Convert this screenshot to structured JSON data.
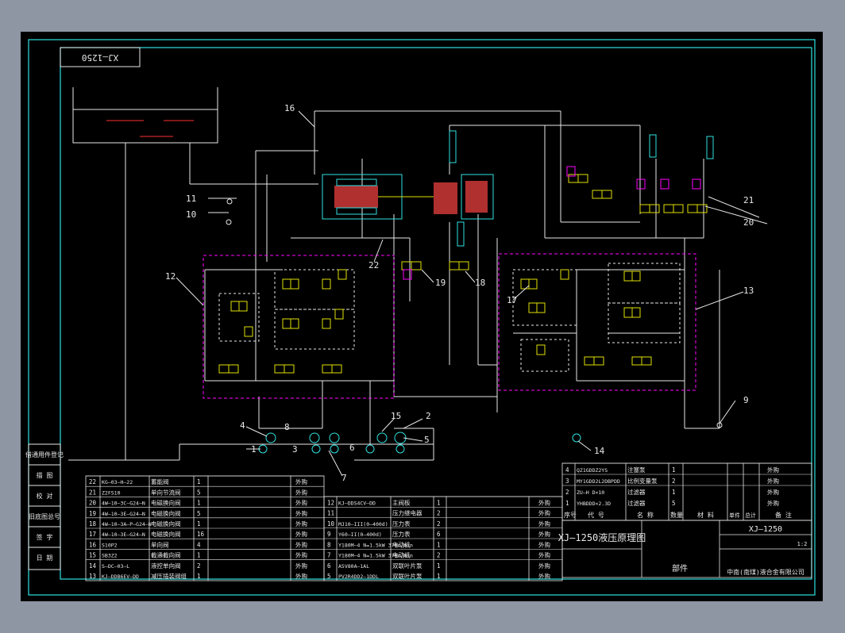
{
  "title_tag": "XJ—1250",
  "drawing": {
    "title": "XJ—1250液压原理图",
    "code": "XJ—1250",
    "part_label": "部件",
    "company": "中南(南煤)液合金有限公司",
    "scale": "1:2"
  },
  "callouts": [
    "1",
    "2",
    "3",
    "4",
    "5",
    "6",
    "7",
    "8",
    "9",
    "10",
    "11",
    "12",
    "13",
    "14",
    "15",
    "16",
    "17",
    "18",
    "19",
    "20",
    "21",
    "22"
  ],
  "left_stamp": [
    "借通用件登记",
    "描 图",
    "校 对",
    "旧底图总号",
    "签 字",
    "日 期"
  ],
  "parts_left": [
    {
      "no": "22",
      "code": "KG—03—H—22",
      "name": "蓄能阀",
      "qty": "1",
      "note": "外购"
    },
    {
      "no": "21",
      "code": "Z2FS10",
      "name": "单向节流阀",
      "qty": "5",
      "note": "外购"
    },
    {
      "no": "20",
      "code": "4W—10—3C—G24—N",
      "name": "电磁换向阀",
      "qty": "1",
      "note": "外购"
    },
    {
      "no": "19",
      "code": "4W—10—3E—G24—N",
      "name": "电磁换向阀",
      "qty": "5",
      "note": "外购"
    },
    {
      "no": "18",
      "code": "4W—10—3A—P—G24—N",
      "name": "电磁换向阀",
      "qty": "1",
      "note": "外购"
    },
    {
      "no": "17",
      "code": "4W—10—3E—G24—N",
      "name": "电磁换向阀",
      "qty": "16",
      "note": "外购"
    },
    {
      "no": "16",
      "code": "S10P2",
      "name": "单向阀",
      "qty": "4",
      "note": "外购"
    },
    {
      "no": "15",
      "code": "SB3Z2",
      "name": "截通截向阀",
      "qty": "1",
      "note": "外购"
    },
    {
      "no": "14",
      "code": "S—DC—03—L",
      "name": "液控单向阀",
      "qty": "2",
      "note": "外购"
    },
    {
      "no": "13",
      "code": "KJ—DDB6EV—DD",
      "name": "减压插装阀组",
      "qty": "1",
      "note": "外购"
    }
  ],
  "parts_mid": [
    {
      "no": "12",
      "code": "KJ—DDS4CV—DD",
      "name": "主阀板",
      "qty": "1",
      "note": "外购"
    },
    {
      "no": "11",
      "code": "",
      "name": "压力继电器",
      "qty": "2",
      "note": "外购"
    },
    {
      "no": "10",
      "code": "MJ10—III(0—400d)",
      "name": "压力表",
      "qty": "2",
      "note": "外购"
    },
    {
      "no": "9",
      "code": "Y60—II(0—400d)",
      "name": "压力表",
      "qty": "6",
      "note": "外购"
    },
    {
      "no": "8",
      "code": "Y180M—4 N=1.5kW 370r/min",
      "name": "电动机",
      "qty": "1",
      "note": "外购"
    },
    {
      "no": "7",
      "code": "Y180M—4 N=1.5kW 370r/min",
      "name": "电动机",
      "qty": "2",
      "note": "外购"
    },
    {
      "no": "6",
      "code": "A5V80A—1AL",
      "name": "双联叶片泵",
      "qty": "1",
      "note": "外购"
    },
    {
      "no": "5",
      "code": "PV2R4DD2—1DDL",
      "name": "双联叶片泵",
      "qty": "1",
      "note": "外购"
    }
  ],
  "parts_right": [
    {
      "no": "4",
      "code": "QZ1GDDZ2YS",
      "name": "注塞泵",
      "qty": "1",
      "note": "外购"
    },
    {
      "no": "3",
      "code": "MY1GDD2L2DBPDD",
      "name": "比例变量泵",
      "qty": "2",
      "note": "外购"
    },
    {
      "no": "2",
      "code": "ZU—H D×10",
      "name": "过滤器",
      "qty": "1",
      "note": "外购"
    },
    {
      "no": "1",
      "code": "YHBDDD×2.3D",
      "name": "过滤器",
      "qty": "5",
      "note": "外购"
    }
  ],
  "header_right": [
    "序号",
    "代 号",
    "名 称",
    "数量",
    "材 料",
    "单件",
    "总计",
    "备 注"
  ],
  "title_block_small": [
    "标记",
    "处数",
    "分区",
    "更改文件号",
    "签名",
    "年月日"
  ],
  "colors": {
    "frame": "#30e0e0",
    "text": "#e8e8e8",
    "highlight": "#ff00ff",
    "hatch": "#d04040",
    "line": "#e8e8e8"
  }
}
